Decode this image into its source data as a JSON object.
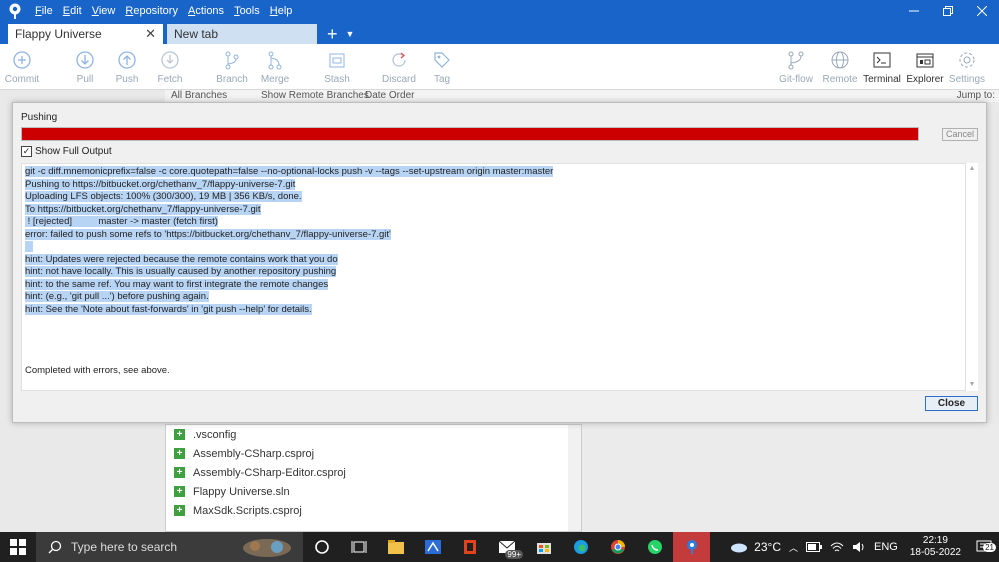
{
  "menu": {
    "items": [
      {
        "label": "File",
        "key": "F",
        "rest": "ile"
      },
      {
        "label": "Edit",
        "key": "E",
        "rest": "dit"
      },
      {
        "label": "View",
        "key": "V",
        "rest": "iew"
      },
      {
        "label": "Repository",
        "key": "R",
        "rest": "epository"
      },
      {
        "label": "Actions",
        "key": "A",
        "rest": "ctions"
      },
      {
        "label": "Tools",
        "key": "T",
        "rest": "ools"
      },
      {
        "label": "Help",
        "key": "H",
        "rest": "elp"
      }
    ]
  },
  "tabs": {
    "active": "Flappy Universe",
    "inactive": "New tab",
    "close_glyph": "✕",
    "add_glyph": "+",
    "menu_glyph": "▼"
  },
  "toolbar": {
    "commit": "Commit",
    "pull": "Pull",
    "push": "Push",
    "fetch": "Fetch",
    "branch": "Branch",
    "merge": "Merge",
    "stash": "Stash",
    "discard": "Discard",
    "tag": "Tag",
    "gitflow": "Git-flow",
    "remote": "Remote",
    "terminal": "Terminal",
    "explorer": "Explorer",
    "settings": "Settings"
  },
  "background": {
    "filter_branches": "All Branches",
    "filter_remote": "Show Remote Branches",
    "filter_order": "Date Order",
    "jump_to": "Jump to:",
    "files": [
      ".vsconfig",
      "Assembly-CSharp.csproj",
      "Assembly-CSharp-Editor.csproj",
      "Flappy Universe.sln",
      "MaxSdk.Scripts.csproj"
    ]
  },
  "dialog": {
    "title": "Pushing",
    "progress_fraction": 1.0,
    "progress_color": "#cc0000",
    "cancel_label": "Cancel",
    "show_full_output_label": "Show Full Output",
    "show_full_output_checked": true,
    "output_lines": [
      "git -c diff.mnemonicprefix=false -c core.quotepath=false --no-optional-locks push -v --tags --set-upstream origin master:master",
      "Pushing to https://bitbucket.org/chethanv_7/flappy-universe-7.git",
      "Uploading LFS objects: 100% (300/300), 19 MB | 356 KB/s, done.",
      "To https://bitbucket.org/chethanv_7/flappy-universe-7.git",
      " ! [rejected]          master -> master (fetch first)",
      "error: failed to push some refs to 'https://bitbucket.org/chethanv_7/flappy-universe-7.git'",
      "   ",
      "hint: Updates were rejected because the remote contains work that you do",
      "hint: not have locally. This is usually caused by another repository pushing",
      "hint: to the same ref. You may want to first integrate the remote changes",
      "hint: (e.g., 'git pull ...') before pushing again.",
      "hint: See the 'Note about fast-forwards' in 'git push --help' for details."
    ],
    "completed_text": "Completed with errors, see above.",
    "close_label": "Close"
  },
  "taskbar": {
    "search_placeholder": "Type here to search",
    "mail_badge": "99+",
    "weather": "23°C",
    "language": "ENG",
    "time": "22:19",
    "date": "18-05-2022",
    "notification_count": "21"
  }
}
